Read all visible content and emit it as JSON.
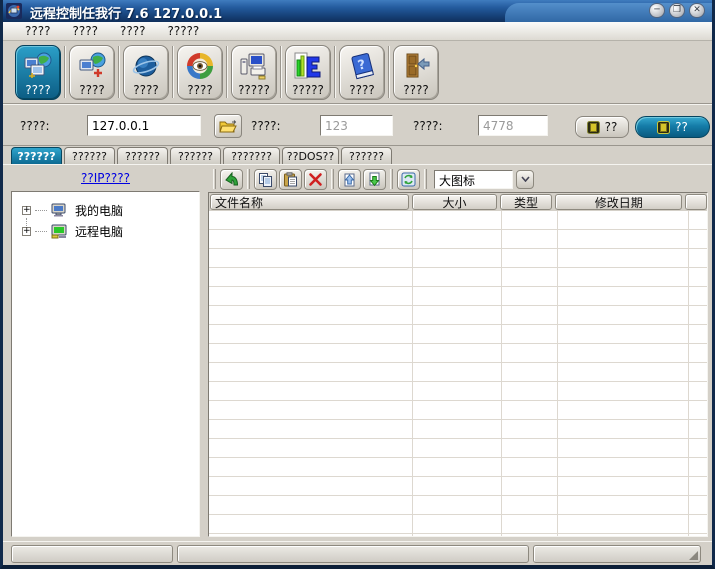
{
  "window": {
    "title": "远程控制任我行 7.6  127.0.0.1",
    "controls": {
      "minimize": "─",
      "maximize": "❐",
      "close": "✕"
    }
  },
  "menu": {
    "items": [
      "????",
      "????",
      "????",
      "?????"
    ]
  },
  "toolbar": {
    "buttons": [
      {
        "label": "????",
        "icon": "network-computers-icon",
        "selected": true
      },
      {
        "label": "????",
        "icon": "add-computer-icon"
      },
      {
        "label": "????",
        "icon": "globe-icon"
      },
      {
        "label": "????",
        "icon": "spy-eye-icon"
      },
      {
        "label": "?????",
        "icon": "computer-printer-icon"
      },
      {
        "label": "?????",
        "icon": "bar-chart-icon"
      },
      {
        "label": "????",
        "icon": "help-book-icon"
      },
      {
        "label": "????",
        "icon": "exit-door-icon"
      }
    ]
  },
  "connection_bar": {
    "host_label": "????:",
    "host_value": "127.0.0.1",
    "port1_label": "????:",
    "port1_value": "123",
    "port2_label": "????:",
    "port2_value": "4778",
    "start_label": "??",
    "stop_label": "??"
  },
  "tabs": [
    {
      "label": "??????",
      "selected": true
    },
    {
      "label": "??????"
    },
    {
      "label": "??????"
    },
    {
      "label": "??????"
    },
    {
      "label": "???????"
    },
    {
      "label": "??DOS??"
    },
    {
      "label": "??????"
    }
  ],
  "sidebar": {
    "link": "??IP????",
    "tree": [
      {
        "label": "我的电脑",
        "icon": "my-computer-icon"
      },
      {
        "label": "远程电脑",
        "icon": "remote-computer-icon"
      }
    ]
  },
  "file_panel": {
    "view_select_value": "大图标",
    "columns": [
      "文件名称",
      "大小",
      "类型",
      "修改日期"
    ]
  },
  "colors": {
    "titlebar_blue": "#235a9d",
    "selected_teal": "#0d6a92",
    "link_blue": "#0000e0",
    "window_bg": "#d4d0c8"
  }
}
